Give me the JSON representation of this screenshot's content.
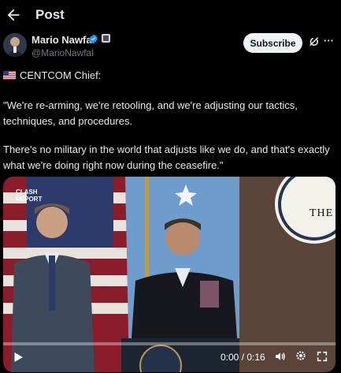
{
  "header": {
    "title": "Post",
    "back_icon": "arrow-left-icon"
  },
  "author": {
    "name": "Mario Nawfal",
    "handle": "@MarioNawfal",
    "verified_color": "#1d9bf0",
    "subscribe_label": "Subscribe"
  },
  "post": {
    "line1": "CENTCOM Chief:",
    "quote1": "\"We're re-arming, we're retooling, and we're adjusting our tactics, techniques, and procedures.",
    "quote2": "There's no military in the world that adjusts like we do, and that's exactly what we're doing right now during the ceasefire.\""
  },
  "video": {
    "watermark": "CLASH REPORT",
    "backdrop_text": "THE",
    "time": "0:00 / 0:16",
    "progress": 0.0,
    "accent_color": "#1d9bf0"
  }
}
